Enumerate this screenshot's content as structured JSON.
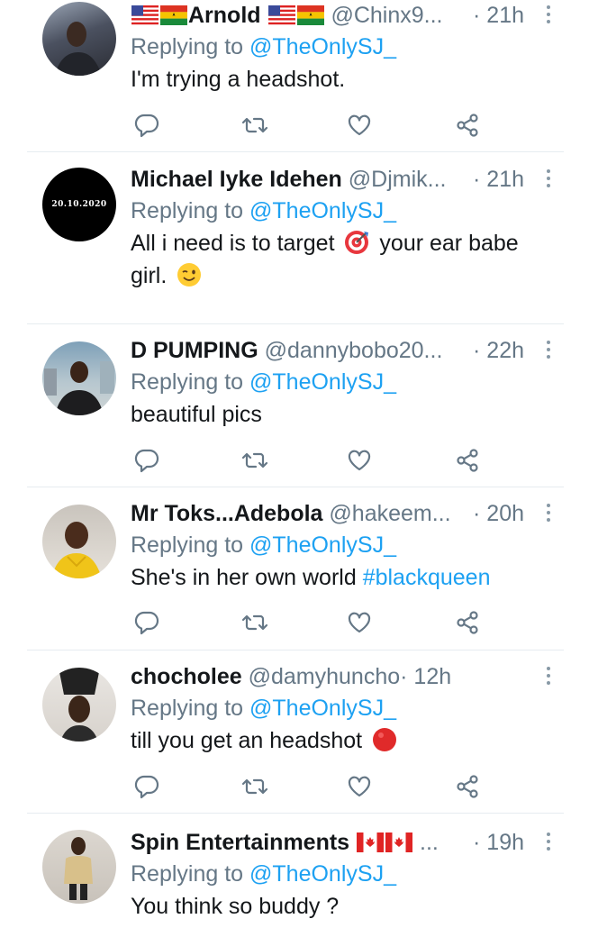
{
  "tweets": [
    {
      "name": "Arnold",
      "handle": "@Chinx9...",
      "time": "· 21h",
      "replying_prefix": "Replying to ",
      "replying_to": "@TheOnlySJ_",
      "text": "I'm trying a headshot.",
      "name_flags_before": [
        "flag-us",
        "flag-ghana"
      ],
      "name_flags_after": [
        "flag-us",
        "flag-ghana"
      ]
    },
    {
      "name": "Michael Iyke Idehen",
      "handle": "@Djmik...",
      "time": "· 21h",
      "replying_prefix": "Replying to ",
      "replying_to": "@TheOnlySJ_",
      "text_line1_a": "All i need is to target ",
      "text_line1_b": " your ear babe",
      "text_line2": "girl. ",
      "avatar_text": "20.10.2020",
      "emojis": [
        "direct-hit-emoji",
        "winking-face-emoji"
      ]
    },
    {
      "name": "D PUMPING",
      "handle": "@dannybobo20...",
      "time": "· 22h",
      "replying_prefix": "Replying to ",
      "replying_to": "@TheOnlySJ_",
      "text": "beautiful pics"
    },
    {
      "name": "Mr Toks...Adebola",
      "handle": "@hakeem...",
      "time": "· 20h",
      "replying_prefix": "Replying to ",
      "replying_to": "@TheOnlySJ_",
      "text": "She's in her own world ",
      "hashtag": "#blackqueen"
    },
    {
      "name": "chocholee",
      "handle": "@damyhuncho",
      "time": "· 12h",
      "replying_prefix": "Replying to ",
      "replying_to": "@TheOnlySJ_",
      "text": "till you get an headshot ",
      "emojis": [
        "red-circle-emoji"
      ]
    },
    {
      "name": "Spin Entertainments",
      "handle": "...",
      "time": "· 19h",
      "replying_prefix": "Replying to ",
      "replying_to": "@TheOnlySJ_",
      "text": "You think so buddy ?",
      "name_flags_after": [
        "flag-canada",
        "flag-canada"
      ]
    }
  ],
  "icons": [
    "reply-icon",
    "retweet-icon",
    "like-icon",
    "share-icon",
    "more-icon"
  ],
  "colors": {
    "link": "#1da1f2",
    "secondary": "#657786",
    "text": "#14171a",
    "divider": "#e6ecf0"
  }
}
